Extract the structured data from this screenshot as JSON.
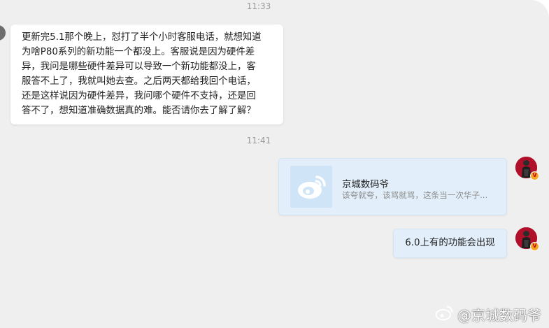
{
  "conversation": {
    "timestamps": [
      "11:33",
      "11:41"
    ],
    "incoming_message": "更新完5.1那个晚上，怼打了半个小时客服电话，就想知道\n为啥P80系列的新功能一个都没上。客服说是因为硬件差\n异，我问是哪些硬件差异可以导致一个新功能都没上，客\n服答不上了，我就叫她去查。之后两天都给我回个电话，\n还是这样说因为硬件差异，我问哪个硬件不支持，还是回\n答不了，想知道准确数据真的难。能否请你去了解了解？",
    "shared_card": {
      "title": "京城数码爷",
      "subtitle": "该夸就夸，该骂就骂，这条当一次华子...",
      "icon": "weibo-logo-icon"
    },
    "outgoing_message": "6.0上有的功能会出现"
  },
  "badges": {
    "verified": "V"
  },
  "watermark": {
    "text": "@京城数码爷",
    "icon": "weibo-logo-icon"
  },
  "colors": {
    "background": "#efefef",
    "incoming_bubble": "#ffffff",
    "outgoing_bubble": "#e2effa",
    "avatar": "#b0102a",
    "verified_badge": "#f5a623"
  }
}
